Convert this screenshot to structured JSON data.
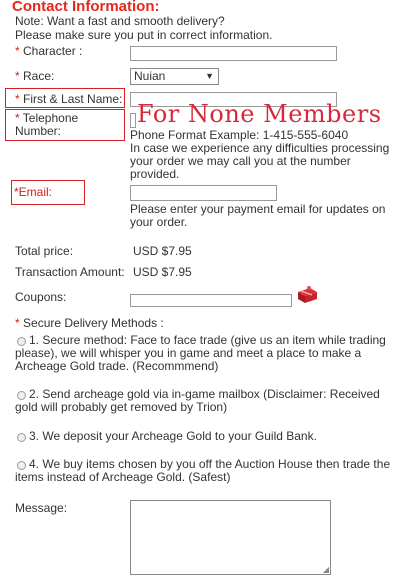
{
  "section_title": "Contact Information:",
  "notes": [
    "Note: Want a fast and smooth delivery?",
    "Please make sure you put in correct information."
  ],
  "fields": {
    "character": {
      "label": "Character :",
      "value": ""
    },
    "race": {
      "label": "Race:",
      "selected": "Nuian"
    },
    "name": {
      "label": "First & Last Name:",
      "value": ""
    },
    "telephone": {
      "label_line1": "Telephone",
      "label_line2": "Number:",
      "value": ""
    },
    "email": {
      "label": "*Email:",
      "value": ""
    }
  },
  "required_mark": "*",
  "overlay_stamp": "For None Members",
  "phone_help": [
    "Phone Format Example: 1-415-555-6040",
    "In case we experience any difficulties processing",
    "your order we may call you at the number",
    "provided."
  ],
  "email_help": [
    "Please enter your payment email for updates on",
    "your order."
  ],
  "totals": {
    "total_label": "Total price:",
    "total_value": "USD $7.95",
    "transaction_label": "Transaction Amount:",
    "transaction_value": "USD $7.95"
  },
  "coupons": {
    "label": "Coupons:",
    "value": "",
    "icon": "gift-icon"
  },
  "delivery": {
    "heading": "Secure Delivery Methods :",
    "options": [
      [
        "1. Secure method: Face to face trade (give us an item while trading",
        "please), we will whisper you in game and meet a place to make a",
        "Archeage Gold trade. (Recommmend)"
      ],
      [
        "2. Send archeage gold via in-game mailbox (Disclaimer: Received",
        "gold will probably get removed by Trion)"
      ],
      [
        "3. We deposit your Archeage Gold to your Guild Bank."
      ],
      [
        "4. We buy items chosen by you off the Auction House then trade the",
        "items instead of Archeage Gold. (Safest)"
      ]
    ]
  },
  "message": {
    "label": "Message:",
    "value": ""
  },
  "colors": {
    "title": "#e8261c",
    "required": "#d41c1c",
    "stamp": "#d42a3a",
    "box": "#d42020"
  }
}
